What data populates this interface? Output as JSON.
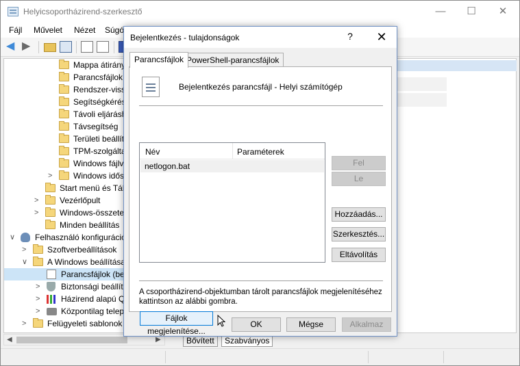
{
  "main": {
    "title": "Helyicsoportházirend-szerkesztő",
    "controls": {
      "minimize": "—",
      "maximize": "☐",
      "close": "✕"
    },
    "menu": [
      "Fájl",
      "Művelet",
      "Nézet",
      "Súgó"
    ],
    "tree": [
      {
        "label": "Mappa átirány",
        "indent": 80,
        "expander": "",
        "icon": "folder"
      },
      {
        "label": "Parancsfájlok",
        "indent": 80,
        "expander": "",
        "icon": "folder"
      },
      {
        "label": "Rendszer-vissz",
        "indent": 80,
        "expander": "",
        "icon": "folder"
      },
      {
        "label": "Segítségkérés",
        "indent": 80,
        "expander": "",
        "icon": "folder"
      },
      {
        "label": "Távoli eljárásh",
        "indent": 80,
        "expander": "",
        "icon": "folder"
      },
      {
        "label": "Távsegítség",
        "indent": 80,
        "expander": "",
        "icon": "folder"
      },
      {
        "label": "Területi beállít",
        "indent": 80,
        "expander": "",
        "icon": "folder"
      },
      {
        "label": "TPM-szolgálta",
        "indent": 80,
        "expander": "",
        "icon": "folder"
      },
      {
        "label": "Windows fájlv",
        "indent": 80,
        "expander": "",
        "icon": "folder"
      },
      {
        "label": "Windows idős",
        "indent": 80,
        "expander": ">",
        "icon": "folder"
      },
      {
        "label": "Start menü és Tál",
        "indent": 60,
        "expander": "",
        "icon": "folder"
      },
      {
        "label": "Vezérlőpult",
        "indent": 60,
        "expander": ">",
        "icon": "folder"
      },
      {
        "label": "Windows-összete",
        "indent": 60,
        "expander": ">",
        "icon": "folder"
      },
      {
        "label": "Minden beállítás",
        "indent": 60,
        "expander": "",
        "icon": "folder"
      },
      {
        "label": "Felhasználó konfiguráció",
        "indent": 24,
        "expander": "∨",
        "icon": "user"
      },
      {
        "label": "Szoftverbeállítások",
        "indent": 42,
        "expander": ">",
        "icon": "folder"
      },
      {
        "label": "A Windows beállítása",
        "indent": 42,
        "expander": "∨",
        "icon": "folder"
      },
      {
        "label": "Parancsfájlok (bej",
        "indent": 62,
        "expander": "",
        "icon": "script",
        "selected": true
      },
      {
        "label": "Biztonsági beállít",
        "indent": 62,
        "expander": ">",
        "icon": "shield"
      },
      {
        "label": "Házirend alapú Q",
        "indent": 62,
        "expander": ">",
        "icon": "chart"
      },
      {
        "label": "Központilag telep",
        "indent": 62,
        "expander": ">",
        "icon": "printer"
      },
      {
        "label": "Felügyeleti sablonok",
        "indent": 42,
        "expander": ">",
        "icon": "folder"
      }
    ],
    "bottom_tabs": [
      "Bővített",
      "Szabványos"
    ]
  },
  "dialog": {
    "title": "Bejelentkezés - tulajdonságok",
    "help": "?",
    "close": "✕",
    "tabs": [
      "Parancsfájlok",
      "PowerShell-parancsfájlok"
    ],
    "heading": "Bejelentkezés parancsfájl - Helyi számítógép",
    "list": {
      "col_name": "Név",
      "col_params": "Paraméterek",
      "rows": [
        {
          "name": "netlogon.bat",
          "params": ""
        }
      ]
    },
    "buttons": {
      "up": "Fel",
      "down": "Le",
      "add": "Hozzáadás...",
      "edit": "Szerkesztés...",
      "remove": "Eltávolítás",
      "show_files": "Fájlok megjelenítése...",
      "ok": "OK",
      "cancel": "Mégse",
      "apply": "Alkalmaz"
    },
    "info_text": "A csoportházirend-objektumban tárolt parancsfájlok megjelenítéséhez kattintson az alábbi gombra."
  }
}
